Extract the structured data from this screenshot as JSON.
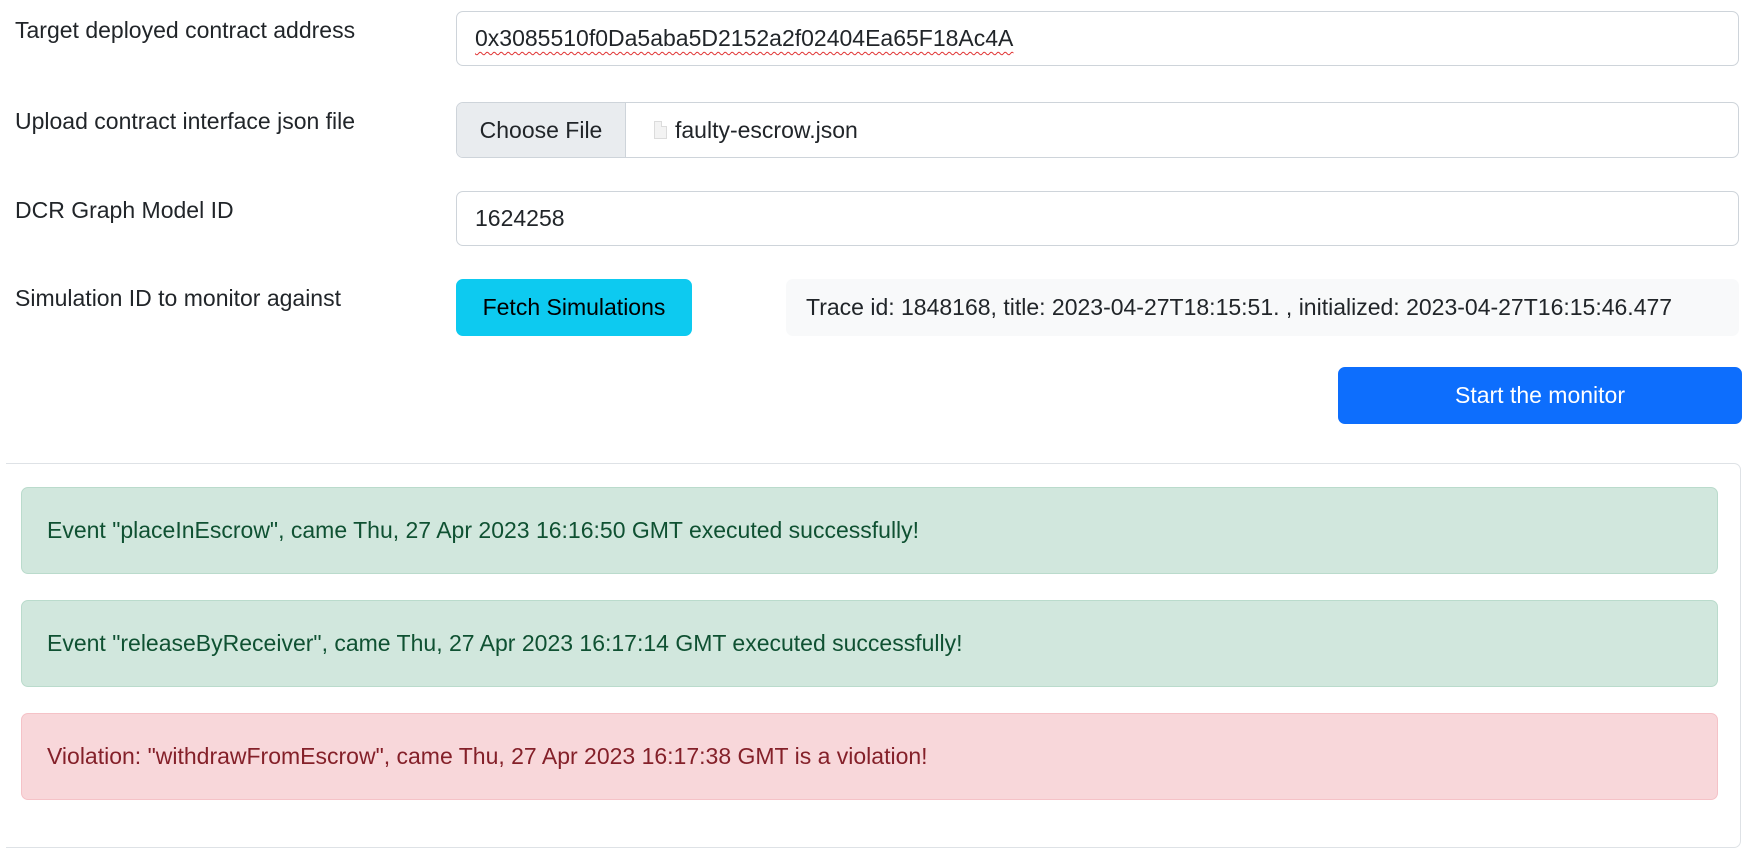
{
  "form": {
    "contract_address": {
      "label": "Target deployed contract address",
      "value": "0x3085510f0Da5aba5D2152a2f02404Ea65F18Ac4A"
    },
    "interface_file": {
      "label": "Upload contract interface json file",
      "button_label": "Choose File",
      "file_name": "faulty-escrow.json",
      "file_icon": "document-icon"
    },
    "model_id": {
      "label": "DCR Graph Model ID",
      "value": "1624258"
    },
    "simulation": {
      "label": "Simulation ID to monitor against",
      "fetch_button": "Fetch Simulations",
      "selected_trace": "Trace id: 1848168, title: 2023-04-27T18:15:51. , initialized: 2023-04-27T16:15:46.477"
    },
    "start_button": "Start the monitor"
  },
  "log": {
    "events": [
      {
        "type": "success",
        "text": "Event \"placeInEscrow\", came Thu, 27 Apr 2023 16:16:50 GMT executed successfully!"
      },
      {
        "type": "success",
        "text": "Event \"releaseByReceiver\", came Thu, 27 Apr 2023 16:17:14 GMT executed successfully!"
      },
      {
        "type": "danger",
        "text": "Violation: \"withdrawFromEscrow\", came Thu, 27 Apr 2023 16:17:38 GMT is a violation!"
      }
    ]
  },
  "colors": {
    "primary": "#0d6efd",
    "info": "#0dcaf0",
    "success_bg": "#d1e7dd",
    "success_text": "#0f5132",
    "danger_bg": "#f8d7da",
    "danger_text": "#842029"
  }
}
